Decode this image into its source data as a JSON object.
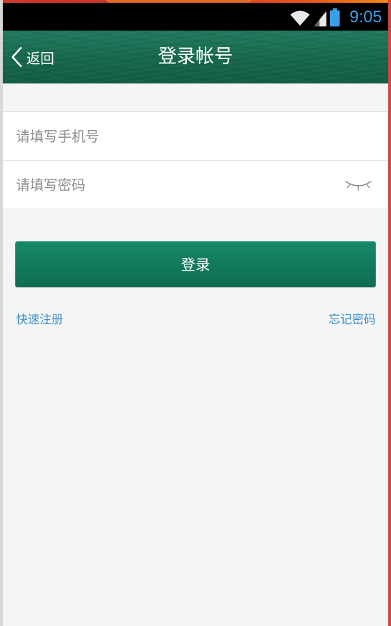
{
  "status_bar": {
    "time": "9:05",
    "icons": [
      "wifi-icon",
      "signal-icon",
      "battery-icon"
    ],
    "time_color": "#3aa0e6"
  },
  "header": {
    "back_label": "返回",
    "title": "登录帐号",
    "background_color": "#17694f"
  },
  "form": {
    "phone_placeholder": "请填写手机号",
    "phone_value": "",
    "password_placeholder": "请填写密码",
    "password_value": "",
    "password_visibility_icon": "eye-closed-icon"
  },
  "actions": {
    "login_label": "登录",
    "register_label": "快速注册",
    "forgot_label": "忘记密码",
    "accent_color": "#13795c",
    "link_color": "#3c8ec9"
  }
}
